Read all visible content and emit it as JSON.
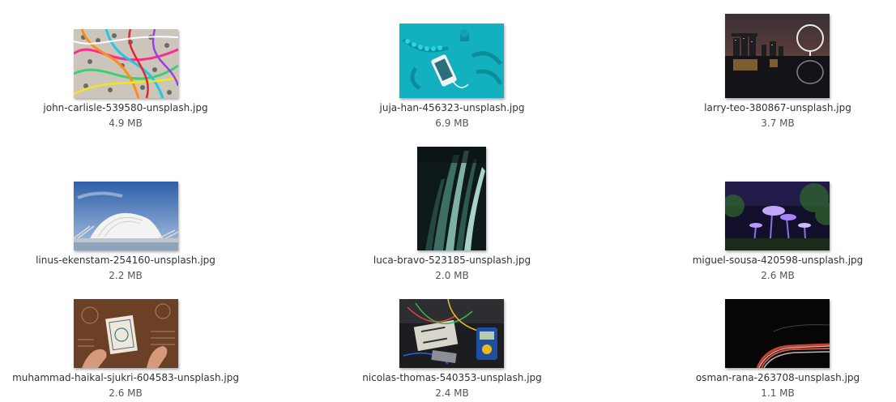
{
  "files": [
    {
      "name": "john-carlisle-539580-unsplash.jpg",
      "size": "4.9 MB"
    },
    {
      "name": "juja-han-456323-unsplash.jpg",
      "size": "6.9 MB"
    },
    {
      "name": "larry-teo-380867-unsplash.jpg",
      "size": "3.7 MB"
    },
    {
      "name": "linus-ekenstam-254160-unsplash.jpg",
      "size": "2.2 MB"
    },
    {
      "name": "luca-bravo-523185-unsplash.jpg",
      "size": "2.0 MB"
    },
    {
      "name": "miguel-sousa-420598-unsplash.jpg",
      "size": "2.6 MB"
    },
    {
      "name": "muhammad-haikal-sjukri-604583-unsplash.jpg",
      "size": "2.6 MB"
    },
    {
      "name": "nicolas-thomas-540353-unsplash.jpg",
      "size": "2.4 MB"
    },
    {
      "name": "osman-rana-263708-unsplash.jpg",
      "size": "1.1 MB"
    }
  ]
}
